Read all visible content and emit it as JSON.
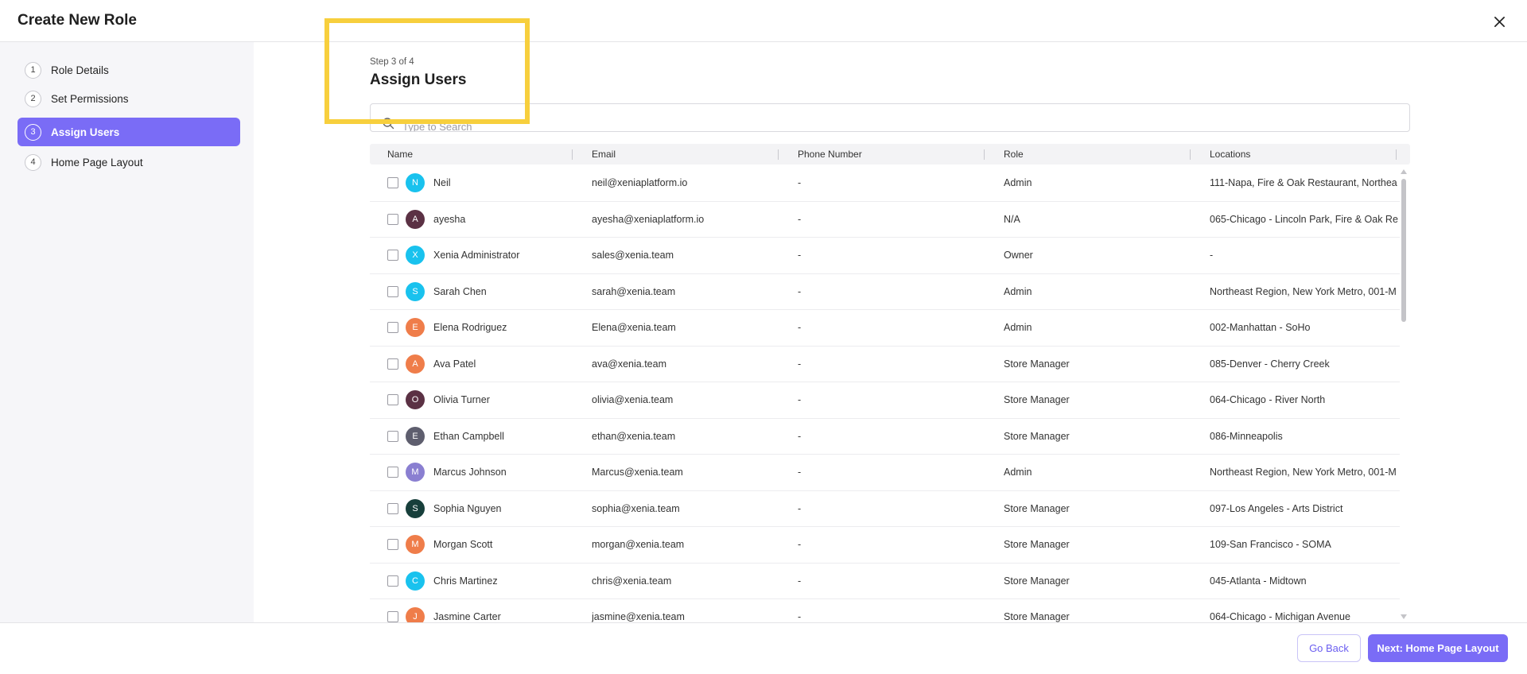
{
  "header": {
    "title": "Create New Role",
    "close_icon": "close-icon"
  },
  "sidebar": {
    "steps": [
      {
        "num": "1",
        "label": "Role Details",
        "active": false
      },
      {
        "num": "2",
        "label": "Set Permissions",
        "active": false
      },
      {
        "num": "3",
        "label": "Assign Users",
        "active": true
      },
      {
        "num": "4",
        "label": "Home Page Layout",
        "active": false
      }
    ]
  },
  "main": {
    "step_indicator": "Step 3 of 4",
    "title": "Assign Users",
    "search": {
      "placeholder": "Type to Search",
      "value": ""
    }
  },
  "table": {
    "columns": [
      "Name",
      "Email",
      "Phone Number",
      "Role",
      "Locations"
    ],
    "rows": [
      {
        "initial": "N",
        "avatar_color": "#19c2ee",
        "name": "Neil",
        "email": "neil@xeniaplatform.io",
        "phone": "-",
        "role": "Admin",
        "locations": "111-Napa, Fire & Oak Restaurant, Northea"
      },
      {
        "initial": "A",
        "avatar_color": "#5b3144",
        "name": "ayesha",
        "email": "ayesha@xeniaplatform.io",
        "phone": "-",
        "role": "N/A",
        "locations": "065-Chicago - Lincoln Park, Fire & Oak Re"
      },
      {
        "initial": "X",
        "avatar_color": "#19c2ee",
        "name": "Xenia Administrator",
        "email": "sales@xenia.team",
        "phone": "-",
        "role": "Owner",
        "locations": "-"
      },
      {
        "initial": "S",
        "avatar_color": "#19c2ee",
        "name": "Sarah Chen",
        "email": "sarah@xenia.team",
        "phone": "-",
        "role": "Admin",
        "locations": "Northeast Region, New York Metro, 001-M"
      },
      {
        "initial": "E",
        "avatar_color": "#ef7d4a",
        "name": "Elena Rodriguez",
        "email": "Elena@xenia.team",
        "phone": "-",
        "role": "Admin",
        "locations": "002-Manhattan - SoHo"
      },
      {
        "initial": "A",
        "avatar_color": "#ef7d4a",
        "name": "Ava Patel",
        "email": "ava@xenia.team",
        "phone": "-",
        "role": "Store Manager",
        "locations": "085-Denver - Cherry Creek"
      },
      {
        "initial": "O",
        "avatar_color": "#5b3144",
        "name": "Olivia Turner",
        "email": "olivia@xenia.team",
        "phone": "-",
        "role": "Store Manager",
        "locations": "064-Chicago - River North"
      },
      {
        "initial": "E",
        "avatar_color": "#5e5e6e",
        "name": "Ethan Campbell",
        "email": "ethan@xenia.team",
        "phone": "-",
        "role": "Store Manager",
        "locations": "086-Minneapolis"
      },
      {
        "initial": "M",
        "avatar_color": "#8a7fd1",
        "name": "Marcus Johnson",
        "email": "Marcus@xenia.team",
        "phone": "-",
        "role": "Admin",
        "locations": "Northeast Region, New York Metro, 001-M"
      },
      {
        "initial": "S",
        "avatar_color": "#173f3b",
        "name": "Sophia Nguyen",
        "email": "sophia@xenia.team",
        "phone": "-",
        "role": "Store Manager",
        "locations": "097-Los Angeles - Arts District"
      },
      {
        "initial": "M",
        "avatar_color": "#ef7d4a",
        "name": "Morgan Scott",
        "email": "morgan@xenia.team",
        "phone": "-",
        "role": "Store Manager",
        "locations": "109-San Francisco - SOMA"
      },
      {
        "initial": "C",
        "avatar_color": "#19c2ee",
        "name": "Chris Martinez",
        "email": "chris@xenia.team",
        "phone": "-",
        "role": "Store Manager",
        "locations": "045-Atlanta - Midtown"
      },
      {
        "initial": "J",
        "avatar_color": "#ef7d4a",
        "name": "Jasmine Carter",
        "email": "jasmine@xenia.team",
        "phone": "-",
        "role": "Store Manager",
        "locations": "064-Chicago - Michigan Avenue"
      }
    ]
  },
  "footer": {
    "back_label": "Go Back",
    "next_label": "Next: Home Page Layout"
  },
  "colors": {
    "accent": "#7a6cf6",
    "highlight": "#f7cf3d"
  }
}
